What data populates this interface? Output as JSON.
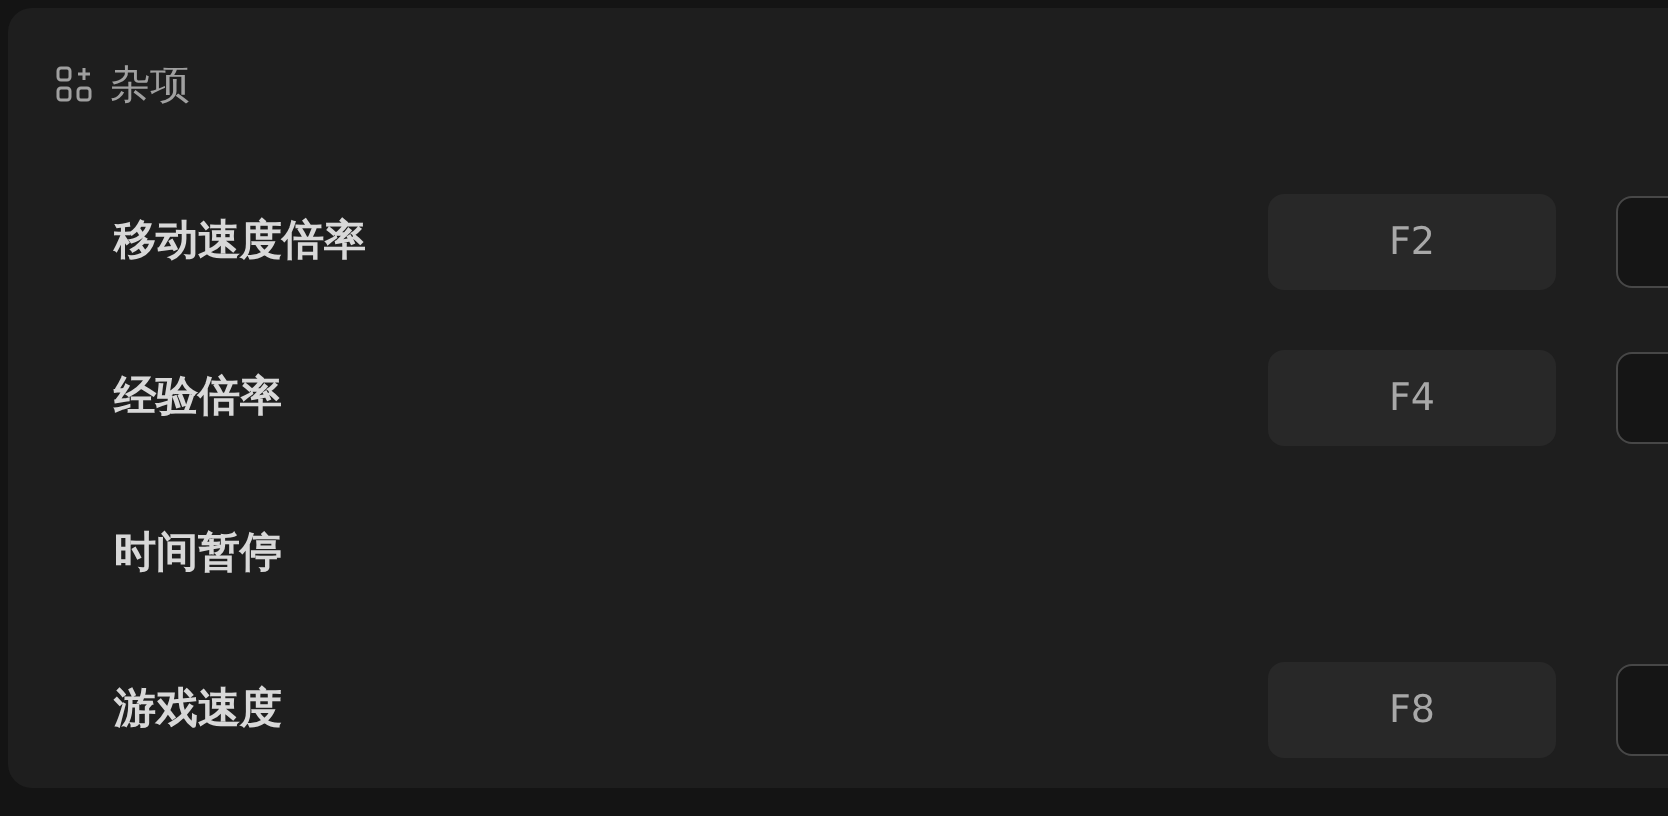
{
  "section": {
    "title": "杂项"
  },
  "rows": [
    {
      "label": "移动速度倍率",
      "hotkey": "F2"
    },
    {
      "label": "经验倍率",
      "hotkey": "F4"
    },
    {
      "label": "时间暂停"
    },
    {
      "label": "游戏速度",
      "hotkey": "F8"
    }
  ]
}
